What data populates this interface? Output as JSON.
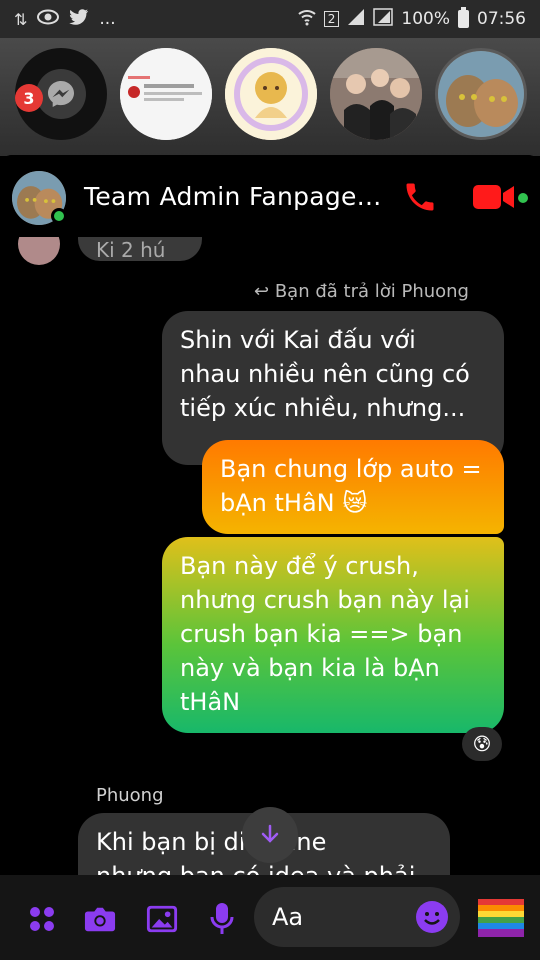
{
  "status_bar": {
    "battery": "100%",
    "time": "07:56",
    "sim": "2",
    "more": "..."
  },
  "chat_heads": {
    "unread_count": "3"
  },
  "header": {
    "title": "Team Admin Fanpage..."
  },
  "messages": {
    "top_partial": "Ki 2 hú",
    "reply_note": "Bạn đã trả lời Phuong",
    "quoted_lines": [
      "Shin với Kai đấu với",
      "nhau nhiều nên cũng có",
      "tiếp xúc nhiều, nhưng..."
    ],
    "out_1_lines": [
      "Bạn chung lớp auto =",
      "bẠn tHâN 😿"
    ],
    "out_2_lines": [
      "Bạn này để ý crush,",
      "nhưng crush bạn này lại",
      "crush bạn kia ==> bạn",
      "này và bạn kia là bẠn",
      "tHâN"
    ],
    "reaction": "😰",
    "sender_name": "Phuong",
    "bottom_lines": [
      "Khi bạn bị di  adline",
      "nhưng bạn có idea và phải"
    ]
  },
  "composer": {
    "placeholder": "Aa"
  },
  "colors": {
    "accent": "#8b3cf0",
    "call_red": "#ff1a1a",
    "online_green": "#31c24f"
  }
}
